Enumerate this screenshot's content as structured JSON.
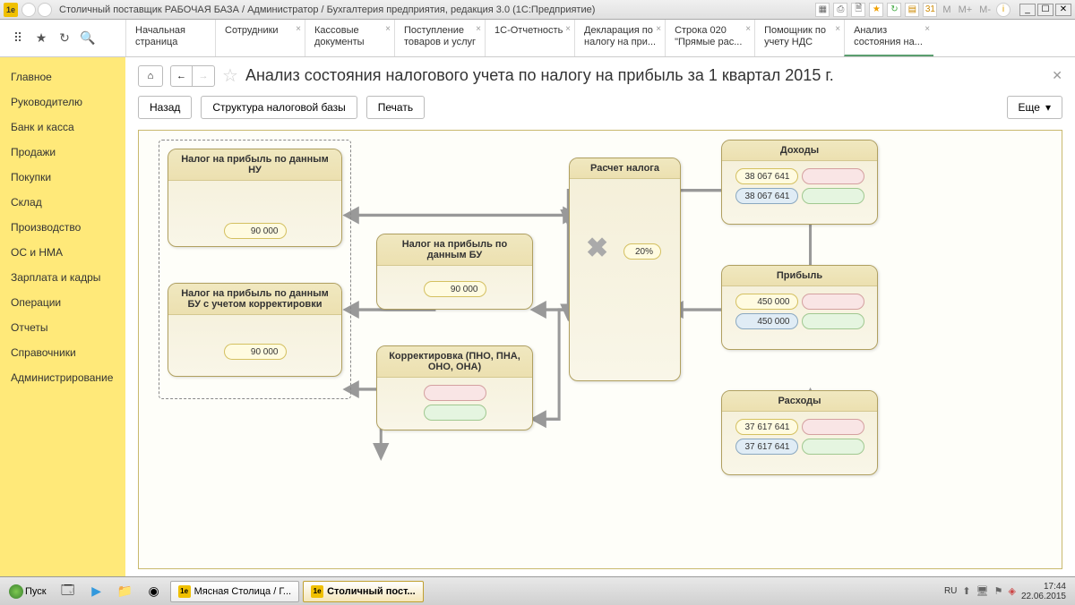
{
  "window": {
    "title": "Столичный поставщик РАБОЧАЯ БАЗА / Администратор / Бухгалтерия предприятия, редакция 3.0  (1С:Предприятие)",
    "logo_text": "1e"
  },
  "title_icons": {
    "m1": "M",
    "m2": "M+",
    "m3": "M-"
  },
  "tabs": [
    {
      "l1": "Начальная",
      "l2": "страница"
    },
    {
      "l1": "Сотрудники",
      "l2": ""
    },
    {
      "l1": "Кассовые",
      "l2": "документы"
    },
    {
      "l1": "Поступление",
      "l2": "товаров и услуг"
    },
    {
      "l1": "1С-Отчетность",
      "l2": ""
    },
    {
      "l1": "Декларация по",
      "l2": "налогу на при..."
    },
    {
      "l1": "Строка 020",
      "l2": "\"Прямые рас..."
    },
    {
      "l1": "Помощник по",
      "l2": "учету НДС"
    },
    {
      "l1": "Анализ",
      "l2": "состояния на..."
    }
  ],
  "sidebar": {
    "items": [
      "Главное",
      "Руководителю",
      "Банк и касса",
      "Продажи",
      "Покупки",
      "Склад",
      "Производство",
      "ОС и НМА",
      "Зарплата и кадры",
      "Операции",
      "Отчеты",
      "Справочники",
      "Администрирование"
    ]
  },
  "page": {
    "title": "Анализ состояния налогового учета по налогу на прибыль за 1 квартал 2015 г.",
    "back": "Назад",
    "structure": "Структура налоговой базы",
    "print": "Печать",
    "more": "Еще"
  },
  "boxes": {
    "nu": {
      "title": "Налог на прибыль по данным НУ",
      "value": "90 000"
    },
    "bu": {
      "title": "Налог на прибыль по данным БУ",
      "value": "90 000"
    },
    "bu_corr": {
      "title": "Налог на прибыль по данным БУ с учетом корректировки",
      "value": "90 000"
    },
    "corr": {
      "title": "Корректировка (ПНО, ПНА, ОНО, ОНА)"
    },
    "calc": {
      "title": "Расчет налога",
      "pct": "20%"
    },
    "income": {
      "title": "Доходы",
      "v1": "38 067 641",
      "v2": "38 067 641"
    },
    "profit": {
      "title": "Прибыль",
      "v1": "450 000",
      "v2": "450 000"
    },
    "expense": {
      "title": "Расходы",
      "v1": "37 617 641",
      "v2": "37 617 641"
    }
  },
  "taskbar": {
    "start": "Пуск",
    "app1": "Мясная Столица / Г...",
    "app2": "Столичный пост...",
    "lang": "RU",
    "time": "17:44",
    "date": "22.06.2015"
  }
}
